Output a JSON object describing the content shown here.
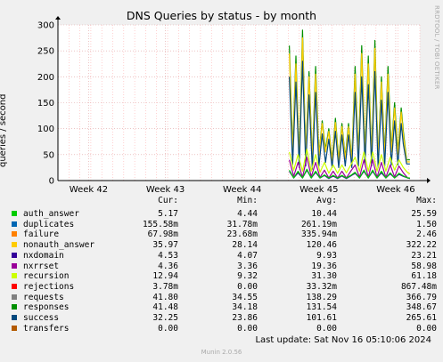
{
  "watermark": "RRDTOOL / TOBI OETIKER",
  "footer": {
    "last_update": "Last update: Sat Nov 16 05:10:06 2024",
    "munin_version": "Munin 2.0.56"
  },
  "legend": {
    "headers": {
      "cur": "Cur:",
      "min": "Min:",
      "avg": "Avg:",
      "max": "Max:"
    },
    "rows": [
      {
        "name": "auth_answer",
        "color": "#00cc00",
        "cur": "5.17",
        "min": "4.44",
        "avg": "10.44",
        "max": "25.59"
      },
      {
        "name": "duplicates",
        "color": "#0066b3",
        "cur": "155.58m",
        "min": "31.78m",
        "avg": "261.19m",
        "max": "1.50"
      },
      {
        "name": "failure",
        "color": "#ff8000",
        "cur": "67.98m",
        "min": "23.68m",
        "avg": "335.94m",
        "max": "2.46"
      },
      {
        "name": "nonauth_answer",
        "color": "#ffcc00",
        "cur": "35.97",
        "min": "28.14",
        "avg": "120.46",
        "max": "322.22"
      },
      {
        "name": "nxdomain",
        "color": "#330099",
        "cur": "4.53",
        "min": "4.07",
        "avg": "9.93",
        "max": "23.21"
      },
      {
        "name": "nxrrset",
        "color": "#990099",
        "cur": "4.36",
        "min": "3.36",
        "avg": "19.36",
        "max": "58.98"
      },
      {
        "name": "recursion",
        "color": "#ccff00",
        "cur": "12.94",
        "min": "9.32",
        "avg": "31.30",
        "max": "61.18"
      },
      {
        "name": "rejections",
        "color": "#ff0000",
        "cur": "3.78m",
        "min": "0.00",
        "avg": "33.32m",
        "max": "867.48m"
      },
      {
        "name": "requests",
        "color": "#808080",
        "cur": "41.80",
        "min": "34.55",
        "avg": "138.29",
        "max": "366.79"
      },
      {
        "name": "responses",
        "color": "#008f00",
        "cur": "41.48",
        "min": "34.18",
        "avg": "131.54",
        "max": "348.67"
      },
      {
        "name": "success",
        "color": "#00487d",
        "cur": "32.25",
        "min": "23.86",
        "avg": "101.61",
        "max": "265.61"
      },
      {
        "name": "transfers",
        "color": "#b35a00",
        "cur": "0.00",
        "min": "0.00",
        "avg": "0.00",
        "max": "0.00"
      }
    ]
  },
  "chart_data": {
    "type": "line",
    "title": "DNS Queries by status - by month",
    "ylabel": "queries / second",
    "xlabel": "",
    "ylim": [
      0,
      300
    ],
    "yticks": [
      0,
      50,
      100,
      150,
      200,
      250,
      300
    ],
    "xlim_days": [
      0,
      33
    ],
    "xticks": [
      {
        "label": "Week 42",
        "day": 2.8
      },
      {
        "label": "Week 43",
        "day": 9.8
      },
      {
        "label": "Week 44",
        "day": 16.8
      },
      {
        "label": "Week 45",
        "day": 23.8
      },
      {
        "label": "Week 46",
        "day": 30.8
      }
    ],
    "grid": true,
    "series": [
      {
        "name": "responses",
        "color": "#008f00",
        "x": [
          21.1,
          21.4,
          21.7,
          22.0,
          22.3,
          22.6,
          22.9,
          23.2,
          23.5,
          23.8,
          24.1,
          24.4,
          24.7,
          25.0,
          25.3,
          25.6,
          25.9,
          26.2,
          26.5,
          26.8,
          27.1,
          27.4,
          27.7,
          28.0,
          28.3,
          28.6,
          28.9,
          29.2,
          29.5,
          29.8,
          30.1,
          30.4,
          30.7,
          31.0,
          31.3,
          31.5,
          31.8,
          32.1
        ],
        "values": [
          260,
          60,
          240,
          40,
          290,
          50,
          210,
          40,
          220,
          50,
          115,
          60,
          100,
          40,
          120,
          40,
          110,
          45,
          110,
          40,
          220,
          45,
          260,
          50,
          240,
          45,
          270,
          40,
          200,
          50,
          220,
          60,
          150,
          55,
          140,
          95,
          40,
          40
        ]
      },
      {
        "name": "nonauth_answer",
        "color": "#ffcc00",
        "x": [
          21.1,
          21.4,
          21.7,
          22.0,
          22.3,
          22.6,
          22.9,
          23.2,
          23.5,
          23.8,
          24.1,
          24.4,
          24.7,
          25.0,
          25.3,
          25.6,
          25.9,
          26.2,
          26.5,
          26.8,
          27.1,
          27.4,
          27.7,
          28.0,
          28.3,
          28.6,
          28.9,
          29.2,
          29.5,
          29.8,
          30.1,
          30.4,
          30.7,
          31.0,
          31.3,
          31.5,
          31.8,
          32.1
        ],
        "values": [
          245,
          55,
          225,
          38,
          275,
          48,
          200,
          38,
          205,
          48,
          110,
          55,
          95,
          38,
          112,
          38,
          104,
          42,
          104,
          38,
          205,
          42,
          245,
          46,
          225,
          42,
          255,
          38,
          190,
          46,
          205,
          55,
          140,
          50,
          132,
          88,
          36,
          36
        ]
      },
      {
        "name": "success",
        "color": "#00487d",
        "x": [
          21.1,
          21.4,
          21.7,
          22.0,
          22.3,
          22.6,
          22.9,
          23.2,
          23.5,
          23.8,
          24.1,
          24.4,
          24.7,
          25.0,
          25.3,
          25.6,
          25.9,
          26.2,
          26.5,
          26.8,
          27.1,
          27.4,
          27.7,
          28.0,
          28.3,
          28.6,
          28.9,
          29.2,
          29.5,
          29.8,
          30.1,
          30.4,
          30.7,
          31.0,
          31.3,
          31.5,
          31.8,
          32.1
        ],
        "values": [
          200,
          30,
          190,
          25,
          230,
          28,
          165,
          22,
          170,
          28,
          90,
          35,
          80,
          25,
          95,
          25,
          88,
          28,
          88,
          25,
          170,
          28,
          200,
          30,
          185,
          28,
          210,
          25,
          155,
          28,
          170,
          30,
          115,
          30,
          110,
          70,
          32,
          32
        ]
      },
      {
        "name": "recursion",
        "color": "#ccff00",
        "x": [
          21.1,
          21.5,
          21.9,
          22.3,
          22.7,
          23.1,
          23.5,
          23.9,
          24.3,
          24.7,
          25.1,
          25.5,
          25.9,
          26.3,
          26.7,
          27.1,
          27.5,
          27.9,
          28.3,
          28.7,
          29.1,
          29.5,
          29.9,
          30.3,
          30.7,
          31.1,
          31.5,
          31.9,
          32.1
        ],
        "values": [
          55,
          20,
          50,
          18,
          60,
          18,
          50,
          16,
          35,
          14,
          30,
          14,
          30,
          15,
          30,
          45,
          18,
          55,
          18,
          55,
          18,
          50,
          18,
          45,
          20,
          40,
          25,
          15,
          13
        ]
      },
      {
        "name": "nxrrset",
        "color": "#990099",
        "x": [
          21.1,
          21.5,
          21.9,
          22.3,
          22.7,
          23.1,
          23.5,
          23.9,
          24.3,
          24.7,
          25.1,
          25.5,
          25.9,
          26.3,
          26.7,
          27.1,
          27.5,
          27.9,
          28.3,
          28.7,
          29.1,
          29.5,
          29.9,
          30.3,
          30.7,
          31.1,
          31.5,
          31.9,
          32.1
        ],
        "values": [
          40,
          8,
          35,
          6,
          45,
          7,
          35,
          6,
          20,
          5,
          18,
          5,
          18,
          5,
          18,
          30,
          6,
          40,
          6,
          40,
          6,
          35,
          6,
          30,
          7,
          28,
          15,
          5,
          4
        ]
      },
      {
        "name": "nxdomain",
        "color": "#330099",
        "x": [
          21.1,
          21.5,
          21.9,
          22.3,
          22.7,
          23.1,
          23.5,
          23.9,
          24.3,
          24.7,
          25.1,
          25.5,
          25.9,
          26.3,
          26.7,
          27.1,
          27.5,
          27.9,
          28.3,
          28.7,
          29.1,
          29.5,
          29.9,
          30.3,
          30.7,
          31.1,
          31.5,
          31.9,
          32.1
        ],
        "values": [
          18,
          5,
          15,
          5,
          20,
          5,
          16,
          5,
          10,
          4,
          9,
          4,
          9,
          4,
          9,
          14,
          5,
          18,
          5,
          18,
          5,
          15,
          5,
          13,
          5,
          12,
          8,
          5,
          4
        ]
      },
      {
        "name": "auth_answer",
        "color": "#00cc00",
        "x": [
          21.1,
          21.5,
          21.9,
          22.3,
          22.7,
          23.1,
          23.5,
          23.9,
          24.3,
          24.7,
          25.1,
          25.5,
          25.9,
          26.3,
          26.7,
          27.1,
          27.5,
          27.9,
          28.3,
          28.7,
          29.1,
          29.5,
          29.9,
          30.3,
          30.7,
          31.1,
          31.5,
          31.9,
          32.1
        ],
        "values": [
          20,
          5,
          18,
          5,
          22,
          5,
          18,
          5,
          11,
          5,
          10,
          5,
          10,
          5,
          10,
          16,
          5,
          20,
          5,
          20,
          5,
          18,
          5,
          15,
          5,
          14,
          9,
          5,
          5
        ]
      }
    ]
  }
}
